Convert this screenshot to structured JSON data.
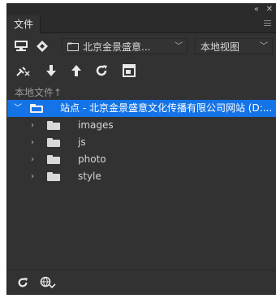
{
  "window": {
    "collapse_glyph": "«",
    "close_glyph": "✕"
  },
  "panel": {
    "tab_label": "文件"
  },
  "toolbar1": {
    "site_select_value": "北京金景盛意...",
    "view_select_value": "本地视图"
  },
  "section": {
    "title": "本地文件",
    "sort_glyph": "↑"
  },
  "tree": {
    "root_label": "站点 - 北京金景盛意文化传播有限公司网站 (D:...",
    "children": [
      {
        "label": "images"
      },
      {
        "label": "js"
      },
      {
        "label": "photo"
      },
      {
        "label": "style"
      }
    ]
  },
  "icons": {
    "connect": "connect-icon",
    "sync": "sync-icon",
    "select-site": "folder-icon",
    "disconnect": "disconnect-icon",
    "get": "down-arrow-icon",
    "put": "up-arrow-icon",
    "refresh": "refresh-icon",
    "expand": "expand-icon",
    "refresh-bottom": "refresh-icon",
    "site-settings": "globe-icon"
  },
  "colors": {
    "panel_bg": "#323232",
    "selection": "#1473e6"
  }
}
